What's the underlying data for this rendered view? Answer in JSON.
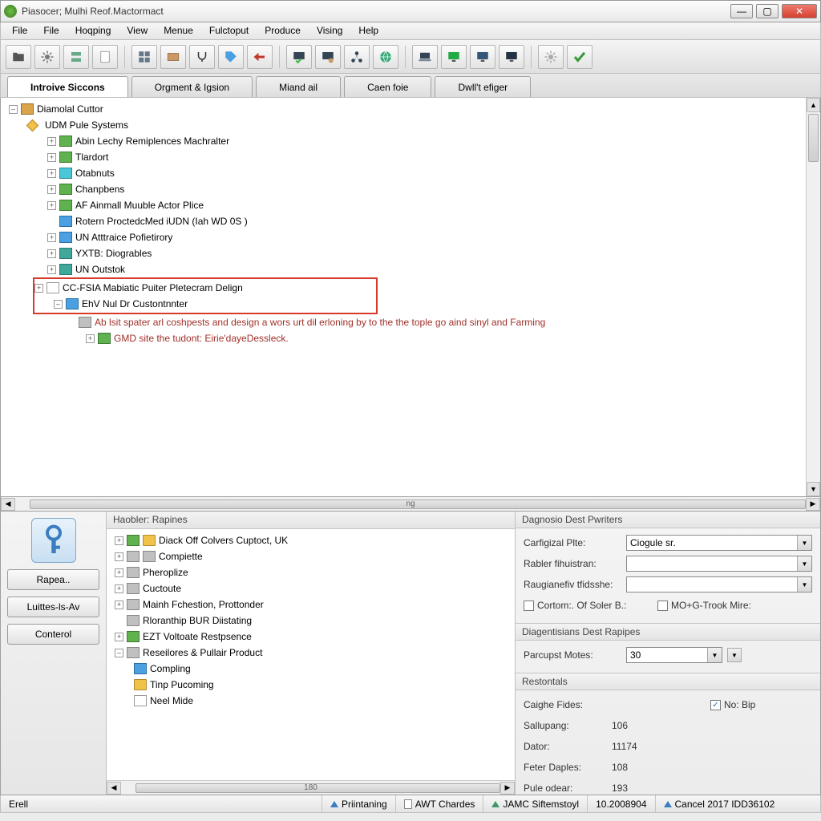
{
  "window": {
    "title": "Piasocer; Mulhi Reof.Mactormact"
  },
  "menu": [
    "File",
    "File",
    "Hoqping",
    "View",
    "Menue",
    "Fulctoput",
    "Produce",
    "Vising",
    "Help"
  ],
  "toolbar_icons": [
    "folder-icon",
    "gear-icon",
    "server-icon",
    "page-icon",
    "grid-icon",
    "card-icon",
    "yoke-icon",
    "tag-icon",
    "arrow-left-icon",
    "screen-check-icon",
    "screen-wrench-icon",
    "network-icon",
    "globe-icon",
    "laptop-icon",
    "monitor-a-icon",
    "monitor-b-icon",
    "monitor-c-icon",
    "cog-grey-icon",
    "check-icon"
  ],
  "tabs": [
    {
      "label": "Introive Siccons",
      "active": true
    },
    {
      "label": "Orgment & Igsion",
      "active": false
    },
    {
      "label": "Miand ail",
      "active": false
    },
    {
      "label": "Caen foie",
      "active": false
    },
    {
      "label": "Dwll't efiger",
      "active": false
    }
  ],
  "tree": {
    "root": "Diamolal Cuttor",
    "n1": "UDM Pule Systems",
    "items": [
      "Abin Lechy Remiplences Machralter",
      "Tlardort",
      "Otabnuts",
      "Chanpbens",
      "AF Ainmall Muuble Actor Plice",
      "Rotern ProctedcMed iUDN (Iah WD 0S )",
      "UN Atttraice Pofietirory",
      "YXTB: Diogrables",
      "UN Outstok"
    ],
    "hl1": "CC-FSIA Mabiatic Puiter Pletecram Delign",
    "hl2": "EhV Nul Dr Custontnnter",
    "red1": "Ab lsit spater arl coshpests and design a wors urt dil erloning by to the the tople go aind sinyl and Farming",
    "red2": "GMD site the tudont: Eirie'dayeDessleck."
  },
  "hscroll_center": "ng",
  "left_buttons": [
    "Rapea..",
    "Luittes-ls-Av",
    "Conterol"
  ],
  "mid": {
    "title": "Haobler: Rapines",
    "items": [
      "Diack Off Colvers Cuptoct, UK",
      "Compiette",
      "Pheroplize",
      "Cuctoute",
      "Mainh Fchestion, Prottonder",
      "Rloranthip BUR Diistating",
      "EZT Voltoate Restpsence",
      "Reseilores & Pullair Product",
      "Compling",
      "Tinp Pucoming",
      "Neel Mide"
    ],
    "hcenter": "180"
  },
  "right": {
    "sec1_title": "Dagnosio Dest Pwriters",
    "f1_label": "Carfigizal Plte:",
    "f1_value": "Ciogule sr.",
    "f2_label": "Rabler fihuistran:",
    "f2_value": "",
    "f3_label": "Raugianefiv tfidsshe:",
    "f3_value": "",
    "chk1_label": "Cortom:. Of Soler B.:",
    "chk2_label": "MO+G-Trook Mire:",
    "sec2_title": "Diagentisians Dest Rapipes",
    "f4_label": "Parcupst Motes:",
    "f4_value": "30",
    "sec3_title": "Restontals",
    "s1_label": "Caighe Fides:",
    "chk3_label": "No: Bip",
    "s2_label": "Sallupang:",
    "s2_val": "106",
    "s3_label": "Dator:",
    "s3_val": "11174",
    "s4_label": "Feter Daples:",
    "s4_val": "108",
    "s5_label": "Pule odear:",
    "s5_val": "193"
  },
  "status": {
    "left": "Erell",
    "c1": "Priintaning",
    "c2": "AWT Chardes",
    "c3": "JAMC Siftemstoyl",
    "c4": "10.2008904",
    "c5": "Cancel 2017 IDD36102"
  }
}
